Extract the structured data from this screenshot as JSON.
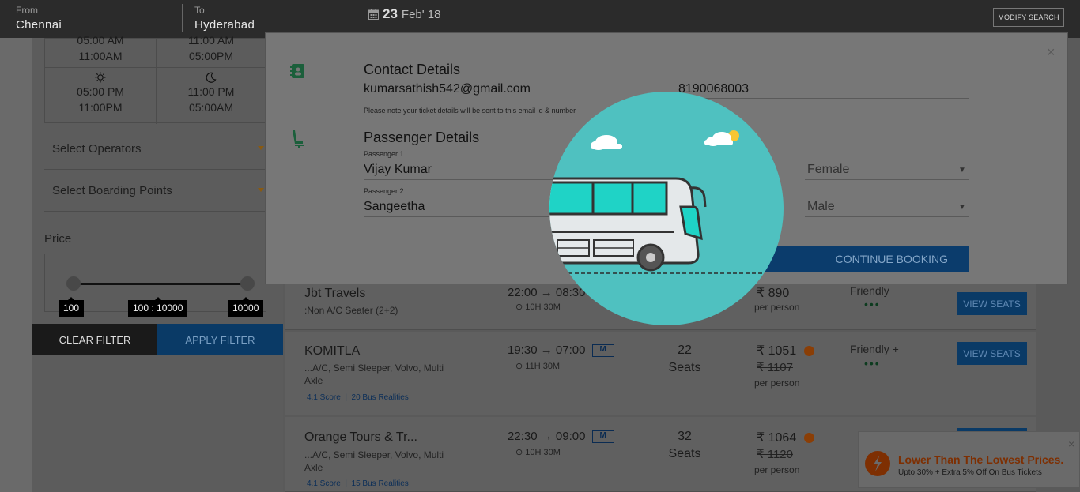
{
  "header": {
    "from_label": "From",
    "from_value": "Chennai",
    "to_label": "To",
    "to_value": "Hyderabad",
    "date_day": "23",
    "date_month": "Feb' 18",
    "modify_button": "MODIFY SEARCH"
  },
  "sidebar": {
    "time_slots": [
      {
        "start": "05:00 AM",
        "end": "11:00AM"
      },
      {
        "start": "11:00 AM",
        "end": "05:00PM"
      },
      {
        "start": "05:00 PM",
        "end": "11:00PM"
      },
      {
        "start": "11:00 PM",
        "end": "05:00AM"
      }
    ],
    "select_operators": "Select Operators",
    "select_boarding": "Select Boarding Points",
    "price_label": "Price",
    "price_min": "100",
    "price_range": "100 : 10000",
    "price_max": "10000",
    "clear_filter": "CLEAR FILTER",
    "apply_filter": "APPLY FILTER"
  },
  "results": [
    {
      "name": "Jbt Travels",
      "type": ":Non A/C Seater (2+2)",
      "depart": "22:00",
      "arrive": "08:30",
      "duration": "10H 30M",
      "fare": "₹ 890",
      "per_person": "per person",
      "rating": "Friendly",
      "view_seats": "VIEW SEATS"
    },
    {
      "name": "KOMITLA",
      "type": "...A/C, Semi Sleeper, Volvo, Multi Axle",
      "score": "4.1 Score",
      "realities": "20 Bus Realities",
      "depart": "19:30",
      "arrive": "07:00",
      "badge": "M",
      "duration": "11H 30M",
      "seats": "22",
      "seats_label": "Seats",
      "fare": "₹ 1051",
      "fare_old": "₹ 1107",
      "per_person": "per person",
      "rating": "Friendly +",
      "view_seats": "VIEW SEATS"
    },
    {
      "name": "Orange Tours & Tr...",
      "type": "...A/C, Semi Sleeper, Volvo, Multi Axle",
      "score": "4.1 Score",
      "realities": "15 Bus Realities",
      "depart": "22:30",
      "arrive": "09:00",
      "badge": "M",
      "duration": "10H 30M",
      "seats": "32",
      "seats_label": "Seats",
      "fare": "₹ 1064",
      "fare_old": "₹ 1120",
      "per_person": "per person"
    }
  ],
  "modal": {
    "contact_title": "Contact Details",
    "email": "kumarsathish542@gmail.com",
    "phone": "8190068003",
    "note": "Please note your ticket details will be sent to this email id & number",
    "passenger_title": "Passenger Details",
    "passengers": [
      {
        "label": "Passenger 1",
        "name": "Vijay Kumar",
        "gender": "Female"
      },
      {
        "label": "Passenger 2",
        "name": "Sangeetha",
        "gender": "Male"
      }
    ],
    "continue_button": "CONTINUE BOOKING",
    "close": "×"
  },
  "toast": {
    "title": "Lower Than The Lowest Prices.",
    "text": "Upto 30% + Extra 5% Off On Bus Tickets",
    "close": "×"
  }
}
